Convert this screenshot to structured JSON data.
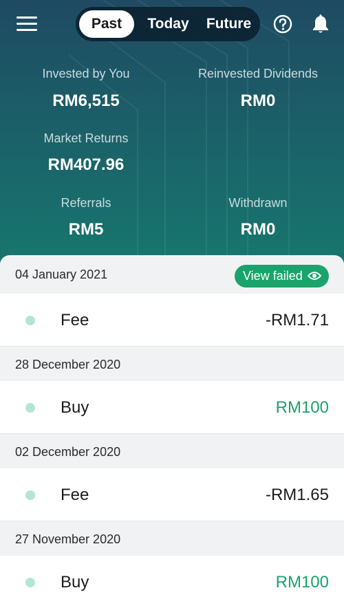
{
  "header": {
    "tabs": [
      {
        "label": "Past",
        "active": true
      },
      {
        "label": "Today",
        "active": false
      },
      {
        "label": "Future",
        "active": false
      }
    ],
    "menu_icon": "hamburger-menu-icon",
    "help_icon": "question-circle-icon",
    "notifications_icon": "bell-icon"
  },
  "summary": {
    "invested": {
      "label": "Invested by You",
      "value": "RM6,515"
    },
    "reinvested": {
      "label": "Reinvested Dividends",
      "value": "RM0"
    },
    "market_returns": {
      "label": "Market Returns",
      "value": "RM407.96"
    },
    "referrals": {
      "label": "Referrals",
      "value": "RM5"
    },
    "withdrawn": {
      "label": "Withdrawn",
      "value": "RM0"
    }
  },
  "view_failed_label": "View failed",
  "transactions": [
    {
      "date": "04 January 2021",
      "type": "Fee",
      "amount": "-RM1.71",
      "amount_color": "#1c1c1c"
    },
    {
      "date": "28 December 2020",
      "type": "Buy",
      "amount": "RM100",
      "amount_color": "#1aa36b"
    },
    {
      "date": "02 December 2020",
      "type": "Fee",
      "amount": "-RM1.65",
      "amount_color": "#1c1c1c"
    },
    {
      "date": "27 November 2020",
      "type": "Buy",
      "amount": "RM100",
      "amount_color": "#1aa36b"
    }
  ],
  "colors": {
    "accent_green": "#1aa36b",
    "dot": "#b3e6d1",
    "header_top": "#1f4a62",
    "header_bottom": "#17786e"
  }
}
